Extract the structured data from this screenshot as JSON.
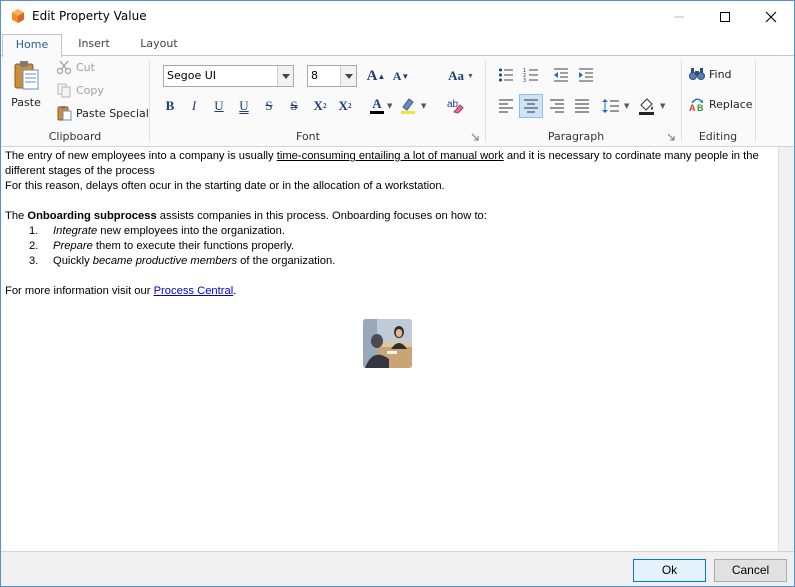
{
  "window": {
    "title": "Edit Property Value"
  },
  "tabs": [
    {
      "label": "Home",
      "active": true
    },
    {
      "label": "Insert",
      "active": false
    },
    {
      "label": "Layout",
      "active": false
    }
  ],
  "clipboard": {
    "paste": "Paste",
    "cut": "Cut",
    "copy": "Copy",
    "paste_special": "Paste Special",
    "label": "Clipboard"
  },
  "font": {
    "family": "Segoe UI",
    "size": "8",
    "label": "Font",
    "grow": "A",
    "shrink": "A",
    "change_case": "Aa",
    "bold": "B",
    "italic": "I",
    "underline": "U",
    "double_underline": "U",
    "strike": "S",
    "double_strike": "S",
    "superscript": "X",
    "superscript_mark": "2",
    "subscript": "X",
    "subscript_mark": "2",
    "font_color": "A",
    "font_color_value": "#000000",
    "highlight_color_value": "#f5e142"
  },
  "paragraph": {
    "label": "Paragraph"
  },
  "editing": {
    "find": "Find",
    "replace": "Replace",
    "label": "Editing"
  },
  "document": {
    "p1_a": "The entry of new employees into a company is usually ",
    "p1_u": "time-consuming entailing a lot of manual work",
    "p1_b": " and it is necessary to cordinate many people in the different stages of the process",
    "p2": "For this reason, delays often ocur in the starting date or in the allocation of a workstation.",
    "p3_a": "The ",
    "p3_b": "Onboarding subprocess",
    "p3_c": " assists companies in this process. Onboarding focuses on how to:",
    "list": [
      {
        "num": "1.",
        "em": "Integrate",
        "rest": " new employees into the organization."
      },
      {
        "num": "2.",
        "em": "Prepare",
        "rest": " them to execute their functions properly."
      },
      {
        "num": "3.",
        "pre": "Quickly ",
        "em": "became productive members",
        "rest": " of the organization."
      }
    ],
    "p4_a": "For more information visit our ",
    "p4_link": "Process Central",
    "p4_b": "."
  },
  "footer": {
    "ok": "Ok",
    "cancel": "Cancel"
  }
}
